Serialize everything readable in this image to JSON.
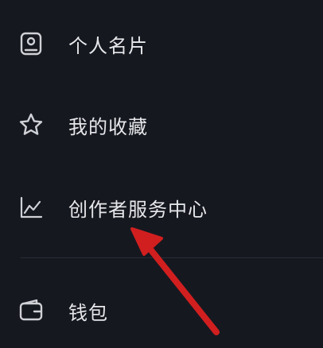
{
  "menu": {
    "items": [
      {
        "label": "个人名片",
        "icon": "id-card-icon"
      },
      {
        "label": "我的收藏",
        "icon": "star-icon"
      },
      {
        "label": "创作者服务中心",
        "icon": "line-chart-icon"
      },
      {
        "label": "钱包",
        "icon": "wallet-icon"
      }
    ]
  },
  "colors": {
    "background": "#161820",
    "text": "#e6e7ea",
    "icon": "#cfd1d6",
    "divider": "#2a2d36",
    "annotation_arrow": "#d11f1f"
  }
}
